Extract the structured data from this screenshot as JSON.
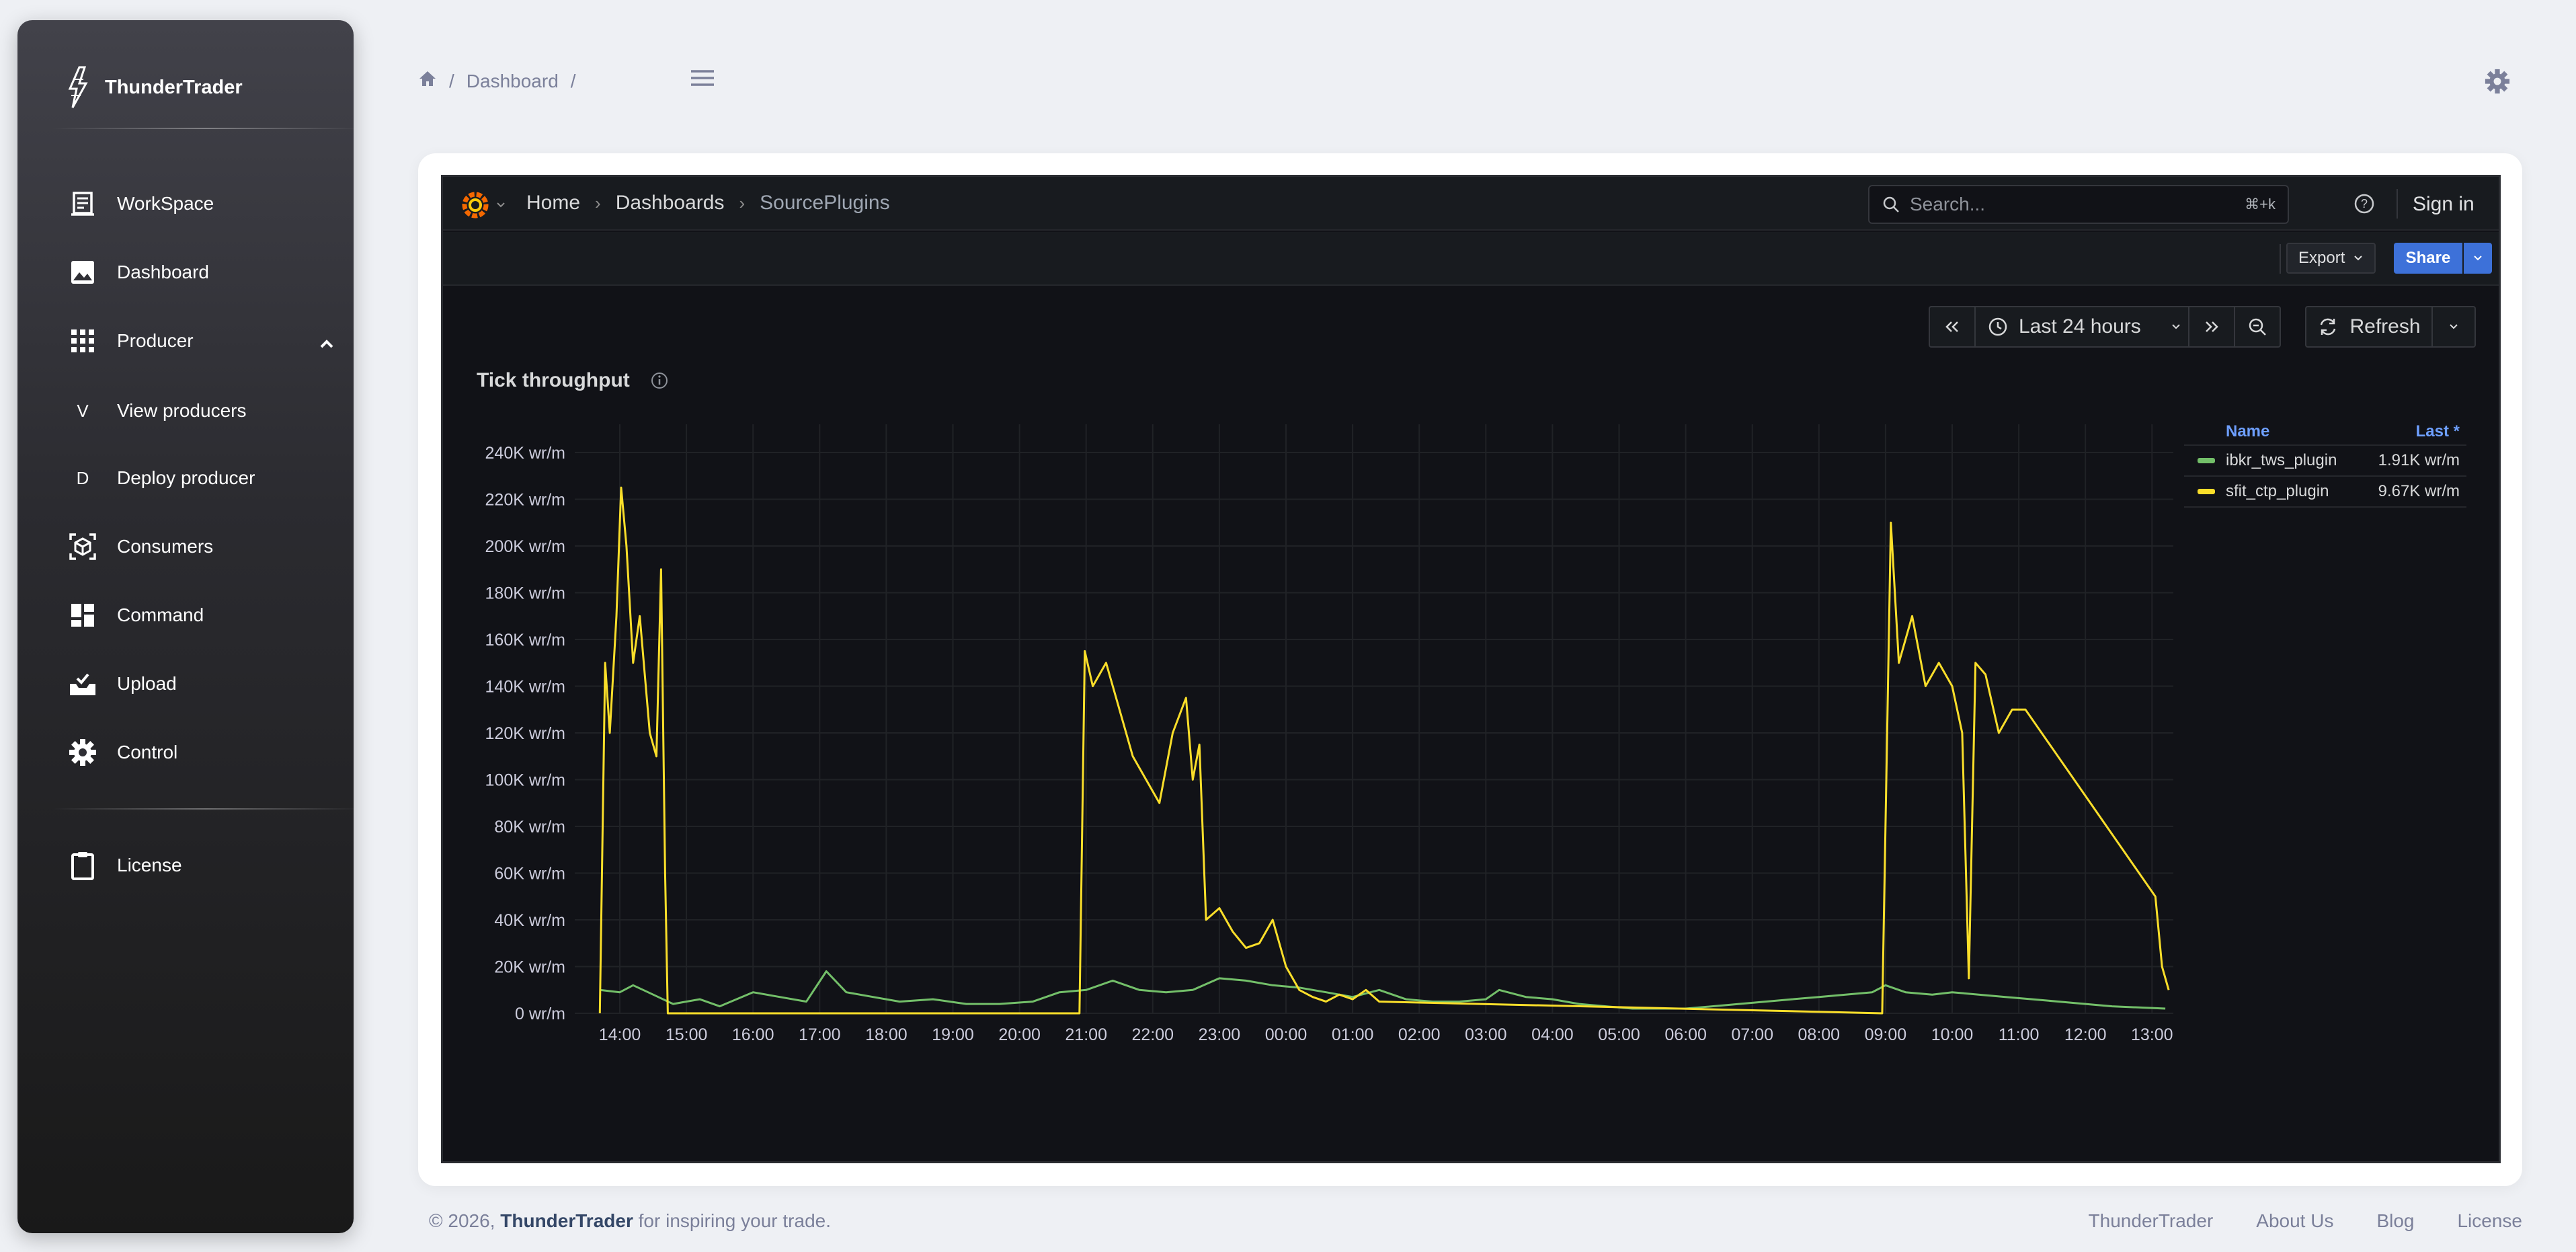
{
  "brand": {
    "name": "ThunderTrader"
  },
  "sidebar": {
    "items": [
      {
        "label": "WorkSpace",
        "icon": "workspace-icon"
      },
      {
        "label": "Dashboard",
        "icon": "image-icon"
      },
      {
        "label": "Producer",
        "icon": "grid-icon",
        "expanded": true
      },
      {
        "label": "View producers",
        "letter": "V"
      },
      {
        "label": "Deploy producer",
        "letter": "D"
      },
      {
        "label": "Consumers",
        "icon": "cube-icon"
      },
      {
        "label": "Command",
        "icon": "dashboard-blocks-icon"
      },
      {
        "label": "Upload",
        "icon": "upload-tray-icon"
      },
      {
        "label": "Control",
        "icon": "gear-icon"
      },
      {
        "label": "License",
        "icon": "clipboard-icon"
      }
    ]
  },
  "header": {
    "breadcrumb": [
      "Dashboard"
    ],
    "separator": "/"
  },
  "grafana": {
    "breadcrumb": [
      "Home",
      "Dashboards",
      "SourcePlugins"
    ],
    "search": {
      "placeholder": "Search...",
      "shortcut": "⌘+k"
    },
    "sign_in": "Sign in",
    "export_label": "Export",
    "share_label": "Share",
    "time_range": "Last 24 hours",
    "refresh_label": "Refresh"
  },
  "panel": {
    "title": "Tick throughput",
    "legend": {
      "headers": {
        "name": "Name",
        "last": "Last *"
      },
      "rows": [
        {
          "name": "ibkr_tws_plugin",
          "last": "1.91K wr/m",
          "color": "#73bf69"
        },
        {
          "name": "sfit_ctp_plugin",
          "last": "9.67K wr/m",
          "color": "#fade2a"
        }
      ]
    }
  },
  "chart_data": {
    "type": "line",
    "title": "Tick throughput",
    "x_ticks": [
      "14:00",
      "15:00",
      "16:00",
      "17:00",
      "18:00",
      "19:00",
      "20:00",
      "21:00",
      "22:00",
      "23:00",
      "00:00",
      "01:00",
      "02:00",
      "03:00",
      "04:00",
      "05:00",
      "06:00",
      "07:00",
      "08:00",
      "09:00",
      "10:00",
      "11:00",
      "12:00",
      "13:00"
    ],
    "y_ticks": [
      "0 wr/m",
      "20K wr/m",
      "40K wr/m",
      "60K wr/m",
      "80K wr/m",
      "100K wr/m",
      "120K wr/m",
      "140K wr/m",
      "160K wr/m",
      "180K wr/m",
      "200K wr/m",
      "220K wr/m",
      "240K wr/m"
    ],
    "ylim": [
      0,
      240000
    ],
    "grid": true,
    "legend_position": "right",
    "series": [
      {
        "name": "sfit_ctp_plugin",
        "color": "#fade2a",
        "points": [
          [
            13.7,
            0
          ],
          [
            13.78,
            150000
          ],
          [
            13.85,
            120000
          ],
          [
            13.95,
            170000
          ],
          [
            14.02,
            225000
          ],
          [
            14.1,
            200000
          ],
          [
            14.2,
            150000
          ],
          [
            14.3,
            170000
          ],
          [
            14.45,
            120000
          ],
          [
            14.55,
            110000
          ],
          [
            14.62,
            190000
          ],
          [
            14.68,
            60000
          ],
          [
            14.72,
            0
          ],
          [
            14.8,
            0
          ],
          [
            20.9,
            0
          ],
          [
            20.98,
            155000
          ],
          [
            21.1,
            140000
          ],
          [
            21.3,
            150000
          ],
          [
            21.5,
            130000
          ],
          [
            21.7,
            110000
          ],
          [
            21.9,
            100000
          ],
          [
            22.1,
            90000
          ],
          [
            22.3,
            120000
          ],
          [
            22.5,
            135000
          ],
          [
            22.6,
            100000
          ],
          [
            22.7,
            115000
          ],
          [
            22.8,
            40000
          ],
          [
            23.0,
            45000
          ],
          [
            23.2,
            35000
          ],
          [
            23.4,
            28000
          ],
          [
            23.6,
            30000
          ],
          [
            23.8,
            40000
          ],
          [
            24.0,
            20000
          ],
          [
            24.2,
            10000
          ],
          [
            24.4,
            7000
          ],
          [
            24.6,
            5000
          ],
          [
            24.8,
            8000
          ],
          [
            25.0,
            6000
          ],
          [
            25.2,
            10000
          ],
          [
            25.4,
            5000
          ],
          [
            32.95,
            0
          ],
          [
            33.08,
            210000
          ],
          [
            33.2,
            150000
          ],
          [
            33.4,
            170000
          ],
          [
            33.6,
            140000
          ],
          [
            33.8,
            150000
          ],
          [
            34.0,
            140000
          ],
          [
            34.15,
            120000
          ],
          [
            34.25,
            15000
          ],
          [
            34.35,
            150000
          ],
          [
            34.5,
            145000
          ],
          [
            34.7,
            120000
          ],
          [
            34.9,
            130000
          ],
          [
            35.1,
            130000
          ],
          [
            37.05,
            50000
          ],
          [
            37.15,
            20000
          ],
          [
            37.25,
            10000
          ]
        ]
      },
      {
        "name": "ibkr_tws_plugin",
        "color": "#73bf69",
        "points": [
          [
            13.7,
            10000
          ],
          [
            14.0,
            9000
          ],
          [
            14.2,
            12000
          ],
          [
            14.5,
            8000
          ],
          [
            14.8,
            4000
          ],
          [
            15.2,
            6000
          ],
          [
            15.5,
            3000
          ],
          [
            16.0,
            9000
          ],
          [
            16.4,
            7000
          ],
          [
            16.8,
            5000
          ],
          [
            17.1,
            18000
          ],
          [
            17.4,
            9000
          ],
          [
            17.8,
            7000
          ],
          [
            18.2,
            5000
          ],
          [
            18.7,
            6000
          ],
          [
            19.2,
            4000
          ],
          [
            19.7,
            4000
          ],
          [
            20.2,
            5000
          ],
          [
            20.6,
            9000
          ],
          [
            21.0,
            10000
          ],
          [
            21.4,
            14000
          ],
          [
            21.8,
            10000
          ],
          [
            22.2,
            9000
          ],
          [
            22.6,
            10000
          ],
          [
            23.0,
            15000
          ],
          [
            23.4,
            14000
          ],
          [
            23.8,
            12000
          ],
          [
            24.2,
            11000
          ],
          [
            24.6,
            9000
          ],
          [
            25.0,
            7000
          ],
          [
            25.4,
            10000
          ],
          [
            25.8,
            6000
          ],
          [
            26.2,
            5000
          ],
          [
            26.6,
            5000
          ],
          [
            27.0,
            6000
          ],
          [
            27.2,
            10000
          ],
          [
            27.6,
            7000
          ],
          [
            28.0,
            6000
          ],
          [
            28.4,
            4000
          ],
          [
            28.8,
            3000
          ],
          [
            29.2,
            2000
          ],
          [
            29.6,
            2000
          ],
          [
            30.0,
            2000
          ],
          [
            30.4,
            3000
          ],
          [
            30.8,
            4000
          ],
          [
            31.2,
            5000
          ],
          [
            31.6,
            6000
          ],
          [
            32.0,
            7000
          ],
          [
            32.4,
            8000
          ],
          [
            32.8,
            9000
          ],
          [
            33.0,
            12000
          ],
          [
            33.3,
            9000
          ],
          [
            33.7,
            8000
          ],
          [
            34.0,
            9000
          ],
          [
            34.4,
            8000
          ],
          [
            34.8,
            7000
          ],
          [
            35.2,
            6000
          ],
          [
            35.6,
            5000
          ],
          [
            36.0,
            4000
          ],
          [
            36.4,
            3000
          ],
          [
            36.8,
            2500
          ],
          [
            37.2,
            2000
          ]
        ]
      }
    ]
  },
  "footer": {
    "copyright_prefix": "© 2026,",
    "brand": "ThunderTrader",
    "tagline": "for inspiring your trade.",
    "links": [
      "ThunderTrader",
      "About Us",
      "Blog",
      "License"
    ]
  }
}
